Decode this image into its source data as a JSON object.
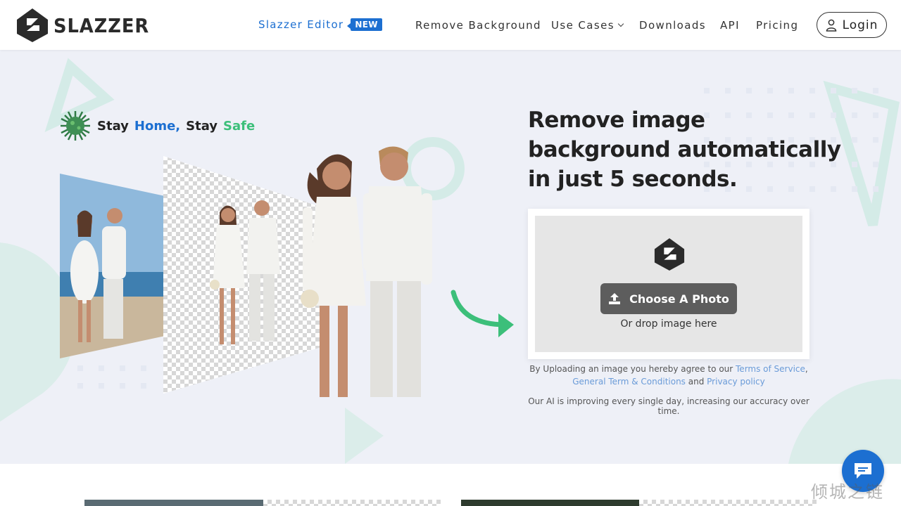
{
  "brand": {
    "name": "SLAZZER"
  },
  "nav": {
    "editor": "Slazzer Editor",
    "new_badge": "NEW",
    "remove_bg": "Remove Background",
    "use_cases": "Use Cases",
    "downloads": "Downloads",
    "api": "API",
    "pricing": "Pricing",
    "login": "Login"
  },
  "hero": {
    "stay_1": "Stay ",
    "stay_home": "Home,",
    "stay_2": " Stay ",
    "stay_safe": "Safe",
    "headline_line1": "Remove image",
    "headline_line2": "background automatically",
    "headline_line3": "in just 5 seconds."
  },
  "upload": {
    "button_label": "Choose A Photo",
    "drop_text": "Or drop image here",
    "terms_prefix": "By Uploading an image you hereby agree to our ",
    "terms_link": "Terms of Service",
    "terms_comma": ",",
    "general_link": "General Term & Conditions",
    "and_text": " and ",
    "privacy_link": "Privacy policy",
    "ai_note": "Our AI is improving every single day, increasing our accuracy over time."
  },
  "watermark": "倾城之链",
  "colors": {
    "accent_blue": "#1c6fd1",
    "accent_green": "#3cbf7a",
    "page_bg": "#eef0f7",
    "button_gray": "#5d5d5d"
  },
  "icons": [
    "logo-icon",
    "user-icon",
    "chevron-down-icon",
    "upload-icon",
    "virus-icon",
    "arrow-icon",
    "chat-icon"
  ]
}
